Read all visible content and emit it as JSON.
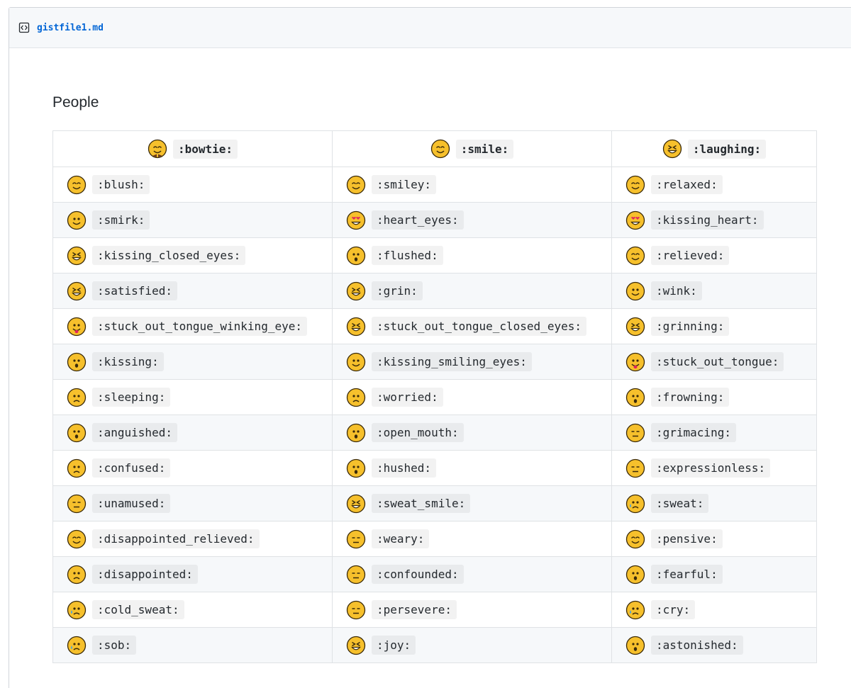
{
  "file": {
    "name": "gistfile1.md",
    "icon": "code-file-icon",
    "link_color": "#0366d6"
  },
  "section": {
    "title": "People"
  },
  "table": {
    "headers": [
      {
        "code": ":bowtie:",
        "icon": "bowtie-icon"
      },
      {
        "code": ":smile:",
        "icon": "smile-icon"
      },
      {
        "code": ":laughing:",
        "icon": "laughing-icon"
      }
    ],
    "rows": [
      [
        ":blush:",
        ":smiley:",
        ":relaxed:"
      ],
      [
        ":smirk:",
        ":heart_eyes:",
        ":kissing_heart:"
      ],
      [
        ":kissing_closed_eyes:",
        ":flushed:",
        ":relieved:"
      ],
      [
        ":satisfied:",
        ":grin:",
        ":wink:"
      ],
      [
        ":stuck_out_tongue_winking_eye:",
        ":stuck_out_tongue_closed_eyes:",
        ":grinning:"
      ],
      [
        ":kissing:",
        ":kissing_smiling_eyes:",
        ":stuck_out_tongue:"
      ],
      [
        ":sleeping:",
        ":worried:",
        ":frowning:"
      ],
      [
        ":anguished:",
        ":open_mouth:",
        ":grimacing:"
      ],
      [
        ":confused:",
        ":hushed:",
        ":expressionless:"
      ],
      [
        ":unamused:",
        ":sweat_smile:",
        ":sweat:"
      ],
      [
        ":disappointed_relieved:",
        ":weary:",
        ":pensive:"
      ],
      [
        ":disappointed:",
        ":confounded:",
        ":fearful:"
      ],
      [
        ":cold_sweat:",
        ":persevere:",
        ":cry:"
      ],
      [
        ":sob:",
        ":joy:",
        ":astonished:"
      ]
    ]
  },
  "colors": {
    "emoji_face": "#f6c02c",
    "emoji_outline": "#3a2a0a",
    "stripe_row": "#f6f8fa"
  }
}
